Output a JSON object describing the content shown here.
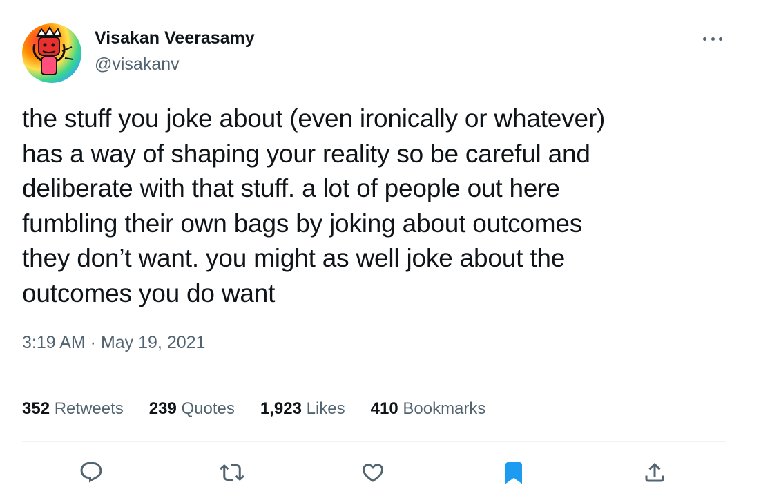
{
  "tweet": {
    "author": {
      "display_name": "Visakan Veerasamy",
      "handle": "@visakanv"
    },
    "text_lines": [
      "the stuff you joke about (even ironically or whatever)",
      "has a way of shaping your reality so be careful and",
      "deliberate with that stuff. a lot of people out here",
      "fumbling their own bags by joking about outcomes",
      "they don’t want. you might as well joke about the",
      "outcomes you do want"
    ],
    "timestamp": "3:19 AM · May 19, 2021",
    "stats": {
      "retweets": {
        "count": "352",
        "label": "Retweets"
      },
      "quotes": {
        "count": "239",
        "label": "Quotes"
      },
      "likes": {
        "count": "1,923",
        "label": "Likes"
      },
      "bookmarks": {
        "count": "410",
        "label": "Bookmarks"
      }
    },
    "actions": [
      {
        "name": "reply",
        "icon": "reply-icon"
      },
      {
        "name": "retweet",
        "icon": "retweet-icon"
      },
      {
        "name": "like",
        "icon": "heart-icon"
      },
      {
        "name": "bookmark",
        "icon": "bookmark-icon",
        "active": true
      },
      {
        "name": "share",
        "icon": "share-icon"
      }
    ]
  },
  "colors": {
    "text_primary": "#0f1419",
    "text_secondary": "#536471",
    "divider": "#eff3f4",
    "accent": "#1d9bf0"
  }
}
